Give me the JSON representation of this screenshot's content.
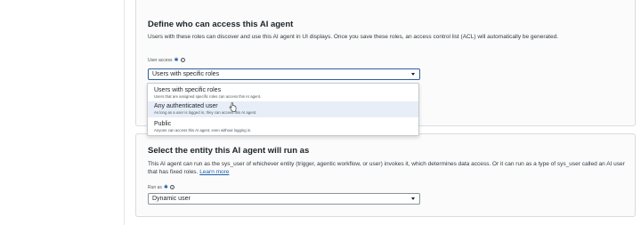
{
  "access_section": {
    "heading": "Define who can access this AI agent",
    "description": "Users with these roles can discover and use this AI agent in UI displays. Once you save these roles, an access control list (ACL) will automatically be generated.",
    "field_label": "User access",
    "selected_value": "Users with specific roles",
    "options": [
      {
        "title": "Users with specific roles",
        "subtitle": "Users that are assigned specific roles can access this AI agent."
      },
      {
        "title": "Any authenticated user",
        "subtitle": "As long as a user is logged in, they can access this AI agent."
      },
      {
        "title": "Public",
        "subtitle": "Anyone can access this AI agent, even without logging in."
      }
    ],
    "hovered_option": "Any authenticated user"
  },
  "run_as_section": {
    "heading": "Select the entity this AI agent will run as",
    "description": "This AI agent can run as the sys_user of whichever entity (trigger, agentic workflow, or user) invokes it, which determines data access. Or it can run as a type of sys_user called an AI user that has fixed roles.",
    "link_text": "Learn more",
    "field_label": "Run as",
    "selected_value": "Dynamic user"
  },
  "required_mark": "✱",
  "info_mark": "i",
  "colors": {
    "accent": "#1f5ea8",
    "hover": "#e8eef7"
  }
}
